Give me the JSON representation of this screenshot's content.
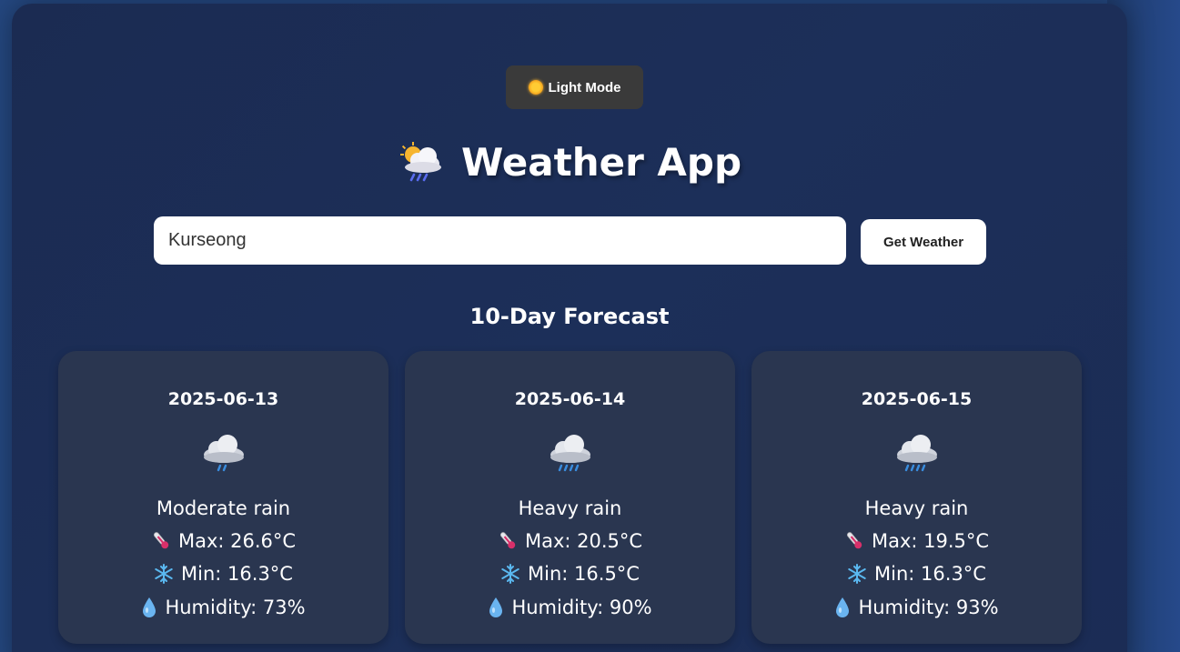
{
  "header": {
    "mode_toggle_label": "Light Mode",
    "title": "Weather App"
  },
  "search": {
    "value": "Kurseong",
    "button_label": "Get Weather"
  },
  "forecast": {
    "heading": "10-Day Forecast",
    "days": [
      {
        "date": "2025-06-13",
        "icon": "rain-cloud-icon",
        "condition": "Moderate rain",
        "max": "Max: 26.6°C",
        "min": "Min: 16.3°C",
        "humidity": "Humidity: 73%"
      },
      {
        "date": "2025-06-14",
        "icon": "rain-cloud-icon",
        "condition": "Heavy rain",
        "max": "Max: 20.5°C",
        "min": "Min: 16.5°C",
        "humidity": "Humidity: 90%"
      },
      {
        "date": "2025-06-15",
        "icon": "rain-cloud-icon",
        "condition": "Heavy rain",
        "max": "Max: 19.5°C",
        "min": "Min: 16.3°C",
        "humidity": "Humidity: 93%"
      }
    ]
  },
  "colors": {
    "page_background": "#24477f",
    "app_background": "#1c2f59",
    "card_background": "#2a3650",
    "toggle_background": "#3a3a3a"
  }
}
